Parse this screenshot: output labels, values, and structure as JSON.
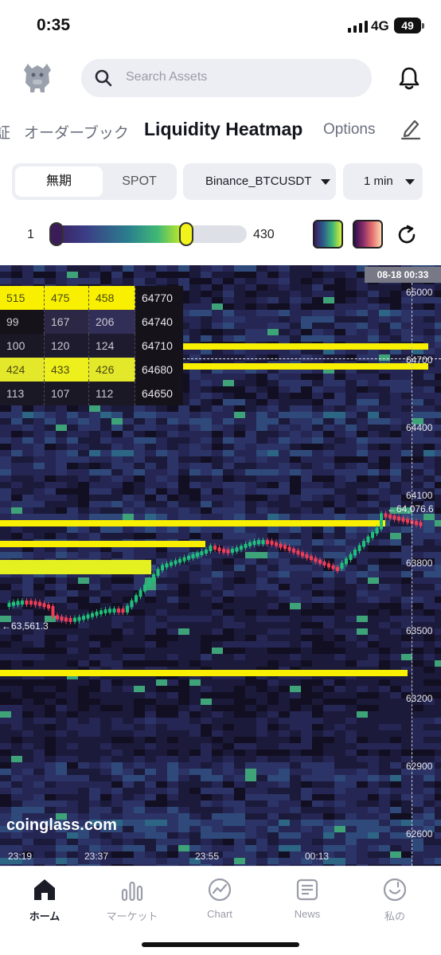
{
  "status_bar": {
    "time": "0:35",
    "network": "4G",
    "battery": "49"
  },
  "header": {
    "search_placeholder": "Search Assets"
  },
  "tabs": [
    {
      "label": "証"
    },
    {
      "label": "オーダーブック"
    },
    {
      "label": "Liquidity Heatmap"
    },
    {
      "label": "Options"
    }
  ],
  "controls": {
    "segment_on": "無期",
    "segment_off": "SPOT",
    "exchange": "Binance_BTCUSDT",
    "interval": "1 min"
  },
  "range": {
    "min": "1",
    "max": "430",
    "low_fraction": 0.0,
    "high_fraction": 0.73
  },
  "heatmap": {
    "time_badge": "08-18 00:33",
    "price_labels": [
      "65000",
      "64700",
      "64400",
      "64100",
      "63800",
      "63500",
      "63200",
      "62900",
      "62600"
    ],
    "time_labels": [
      "23:19",
      "23:37",
      "23:55",
      "00:13"
    ],
    "current_price_mark": "←64,076.6",
    "start_price_mark": "←63,561.3",
    "watermark": "coinglass.com",
    "colors": {
      "max": "#f8f000",
      "bg": "#191731",
      "up": "#1fc07a",
      "down": "#f03c56"
    }
  },
  "order_book": [
    {
      "c1": "515",
      "c2": "475",
      "c3": "458",
      "price": "64770"
    },
    {
      "c1": "99",
      "c2": "167",
      "c3": "206",
      "price": "64740"
    },
    {
      "c1": "100",
      "c2": "120",
      "c3": "124",
      "price": "64710"
    },
    {
      "c1": "424",
      "c2": "433",
      "c3": "426",
      "price": "64680"
    },
    {
      "c1": "113",
      "c2": "107",
      "c3": "112",
      "price": "64650"
    }
  ],
  "bottom_nav": [
    {
      "label": "ホーム",
      "icon": "home-icon"
    },
    {
      "label": "マーケット",
      "icon": "market-icon"
    },
    {
      "label": "Chart",
      "icon": "chart-icon"
    },
    {
      "label": "News",
      "icon": "news-icon"
    },
    {
      "label": "私の",
      "icon": "profile-icon"
    }
  ]
}
